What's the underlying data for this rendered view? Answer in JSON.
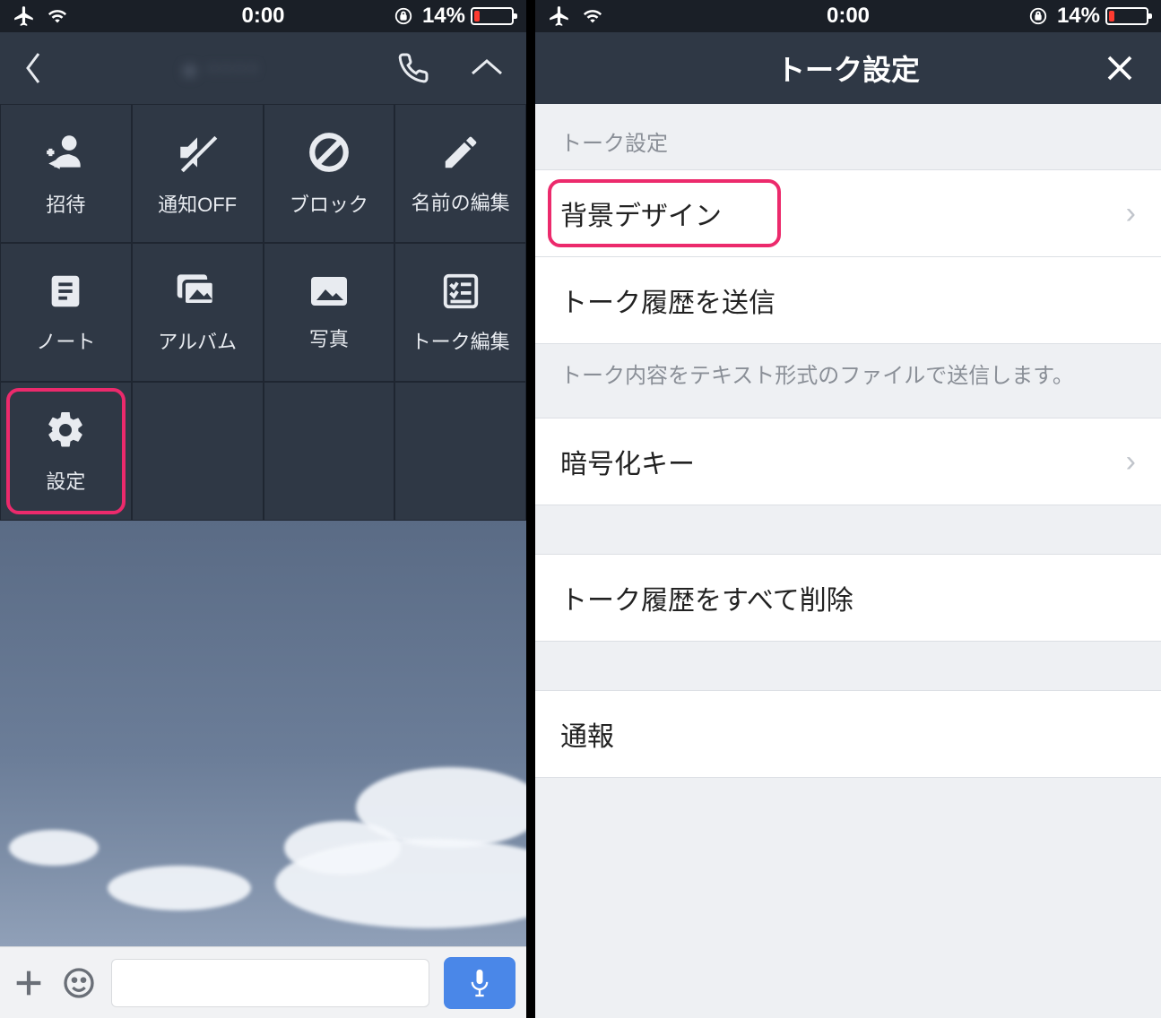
{
  "status": {
    "time": "0:00",
    "battery_pct": "14%"
  },
  "left": {
    "header": {
      "title_blurred": "● ････"
    },
    "tiles": [
      {
        "id": "invite",
        "label": "招待"
      },
      {
        "id": "notify-off",
        "label": "通知OFF"
      },
      {
        "id": "block",
        "label": "ブロック"
      },
      {
        "id": "edit-name",
        "label": "名前の編集"
      },
      {
        "id": "note",
        "label": "ノート"
      },
      {
        "id": "album",
        "label": "アルバム"
      },
      {
        "id": "photo",
        "label": "写真"
      },
      {
        "id": "talk-edit",
        "label": "トーク編集"
      },
      {
        "id": "settings",
        "label": "設定",
        "highlight": true
      }
    ]
  },
  "right": {
    "header_title": "トーク設定",
    "section_label": "トーク設定",
    "rows": {
      "background_design": "背景デザイン",
      "send_history": "トーク履歴を送信",
      "send_history_desc": "トーク内容をテキスト形式のファイルで送信します。",
      "encryption_key": "暗号化キー",
      "delete_all": "トーク履歴をすべて削除",
      "report": "通報"
    }
  }
}
